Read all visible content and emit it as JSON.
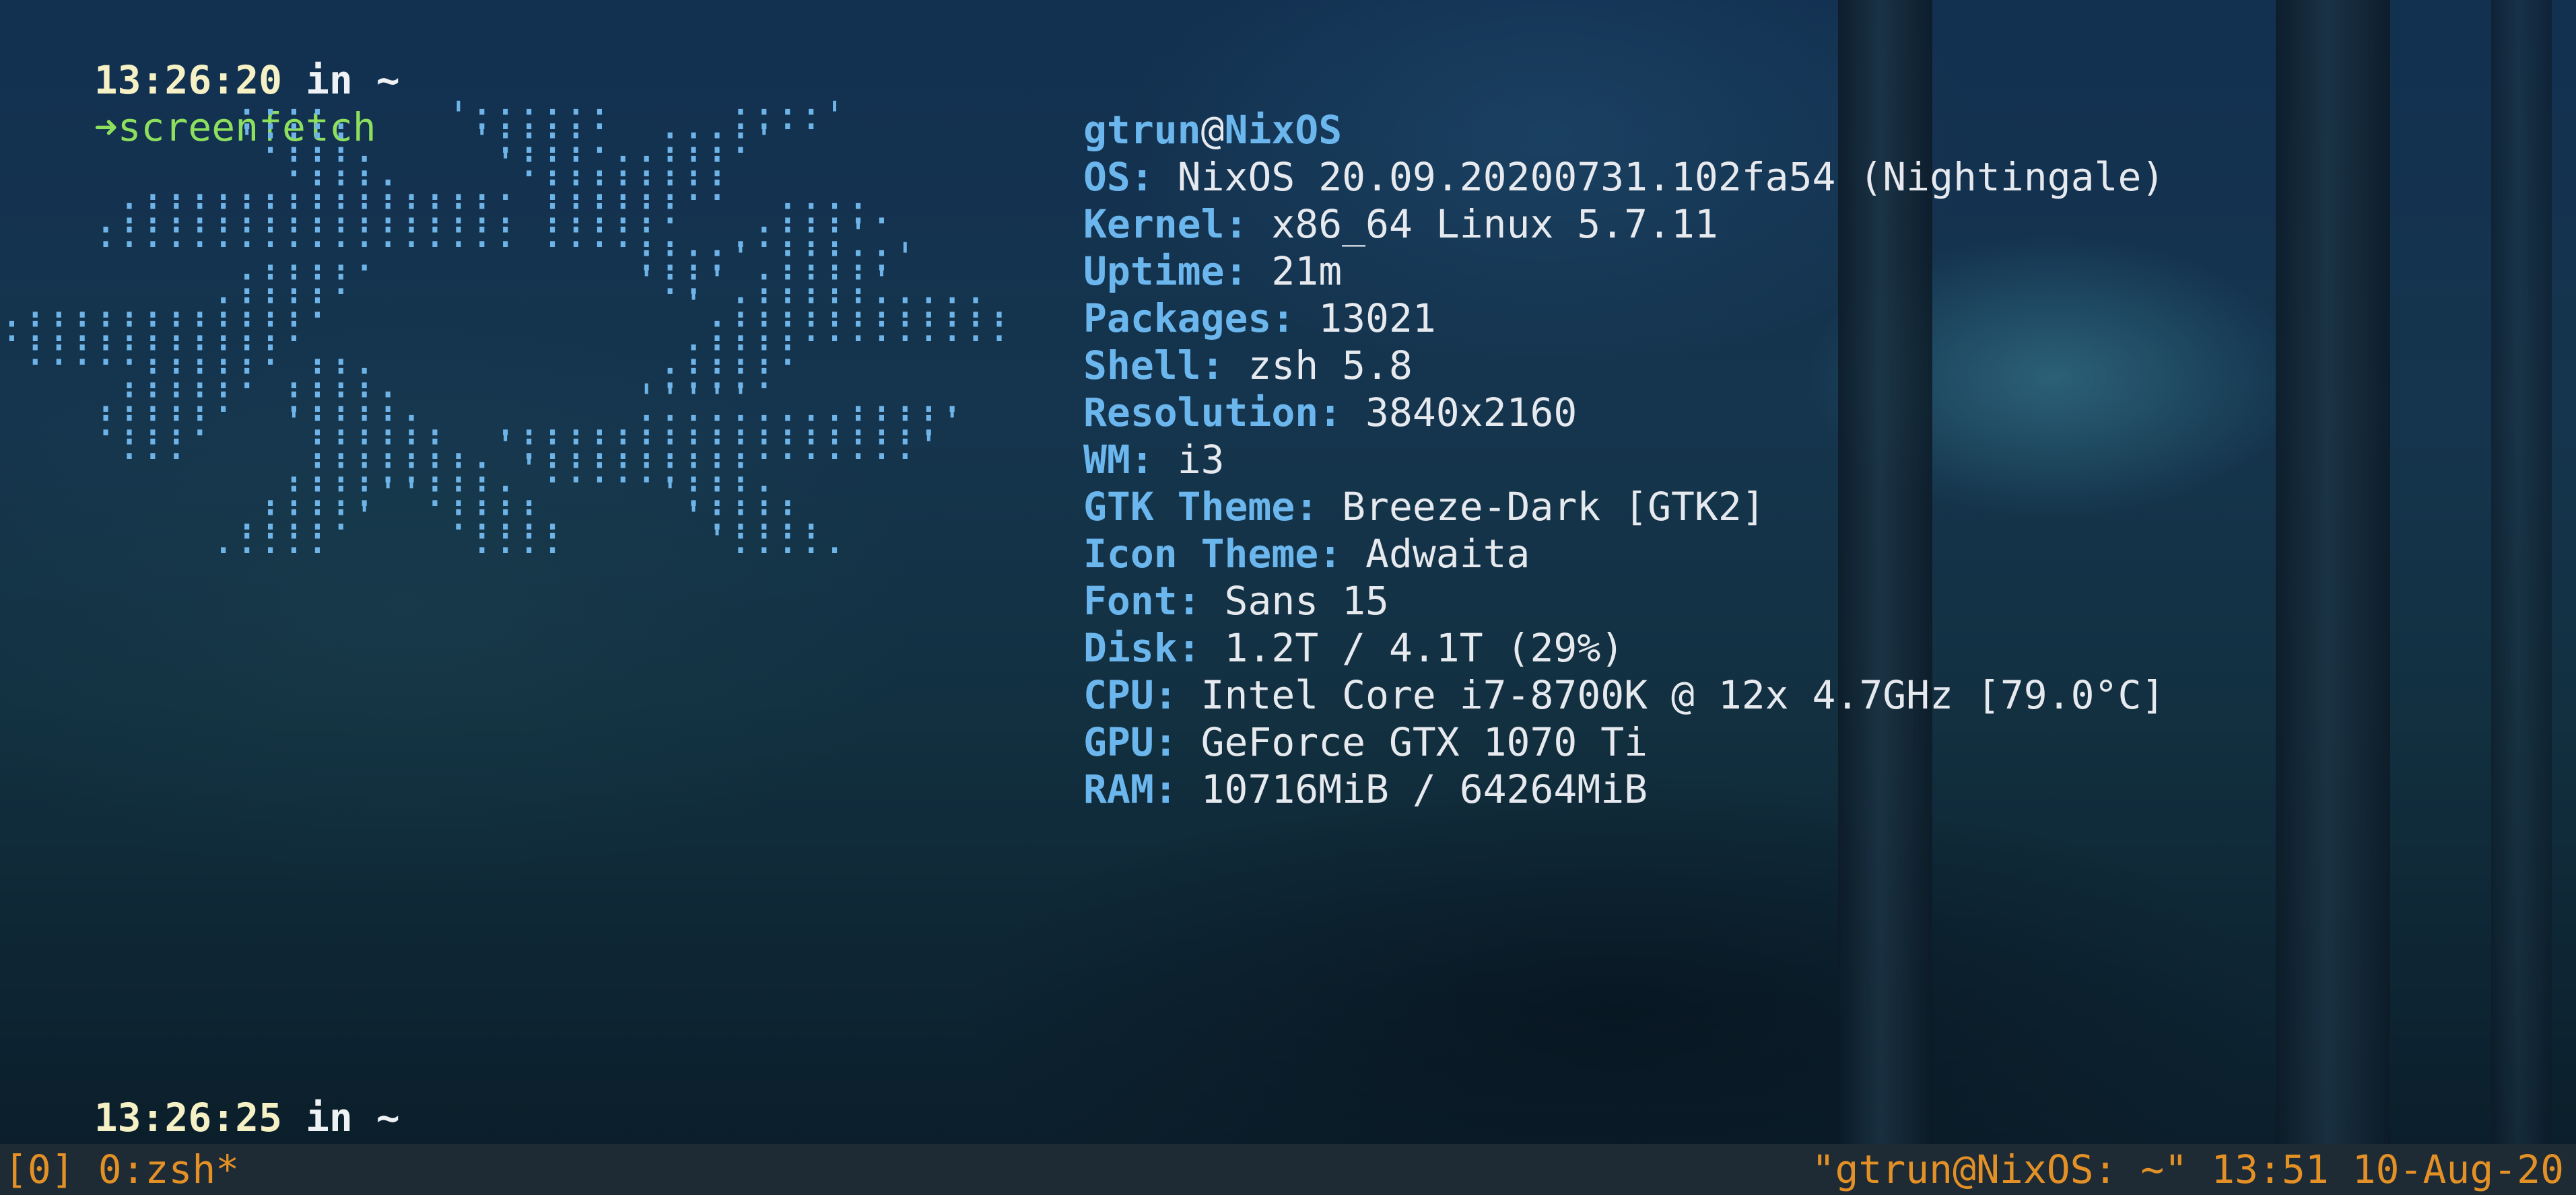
{
  "prompt1": {
    "time": "13:26:20",
    "in_word": "in",
    "dir": "~",
    "arrow": "➜",
    "command": "screenfetch"
  },
  "logo_ascii": "          ::::.    '::::::     ::::'\n          '::::     '::::.  ::::'\n            ::::     ':::.:::::\n      .......::::..... ::::::::\n     ::::::::::::::::. ::::::    ::::.\n    :::::::::::::::::: :::::.  .::::'\n           .....           ::::' :::::'\n          :::::            '::' :::::'\n ........:::::               ' :::::::::::.\n:::::::::::::                 :::::::::::::\n ::::::::::: ..              :::::\n     .::::: .:::            :::::\n    .:::::  :::::          '''''    .....\n    :::::   ':::::.  ......:::::::::::::'\n     :::     ::::::. ':::::::::::::::::'\n            .:::::::: ':::::::::\n           .::::''::::.     '::::.\n          .::::'   ::::.     '::::.\n         .::::      ::::      '::::.",
  "info": {
    "user": "gtrun",
    "at": "@",
    "host": "NixOS",
    "rows": [
      {
        "key": "OS:",
        "value": "NixOS 20.09.20200731.102fa54 (Nightingale)"
      },
      {
        "key": "Kernel:",
        "value": "x86_64 Linux 5.7.11"
      },
      {
        "key": "Uptime:",
        "value": "21m"
      },
      {
        "key": "Packages:",
        "value": "13021"
      },
      {
        "key": "Shell:",
        "value": "zsh 5.8"
      },
      {
        "key": "Resolution:",
        "value": "3840x2160"
      },
      {
        "key": "WM:",
        "value": "i3"
      },
      {
        "key": "GTK Theme:",
        "value": "Breeze-Dark [GTK2]"
      },
      {
        "key": "Icon Theme:",
        "value": "Adwaita"
      },
      {
        "key": "Font:",
        "value": "Sans 15"
      },
      {
        "key": "Disk:",
        "value": "1.2T / 4.1T (29%)"
      },
      {
        "key": "CPU:",
        "value": "Intel Core i7-8700K @ 12x 4.7GHz [79.0°C]"
      },
      {
        "key": "GPU:",
        "value": "GeForce GTX 1070 Ti"
      },
      {
        "key": "RAM:",
        "value": "10716MiB / 64264MiB"
      }
    ]
  },
  "prompt2": {
    "time": "13:26:25",
    "in_word": "in",
    "dir": "~",
    "arrow": "➜"
  },
  "tmux": {
    "session": "[0]",
    "window": "0:zsh*",
    "title": "\"gtrun@NixOS: ~\"",
    "clock": "13:51",
    "date": "10-Aug-20"
  },
  "colors": {
    "prompt_time": "#f5f1c5",
    "prompt_arrow": "#8ddf5e",
    "info_key": "#6cb6ee",
    "logo": "#6fb4e8",
    "tmux_text": "#e39126",
    "tmux_bg": "#1e2a34"
  }
}
